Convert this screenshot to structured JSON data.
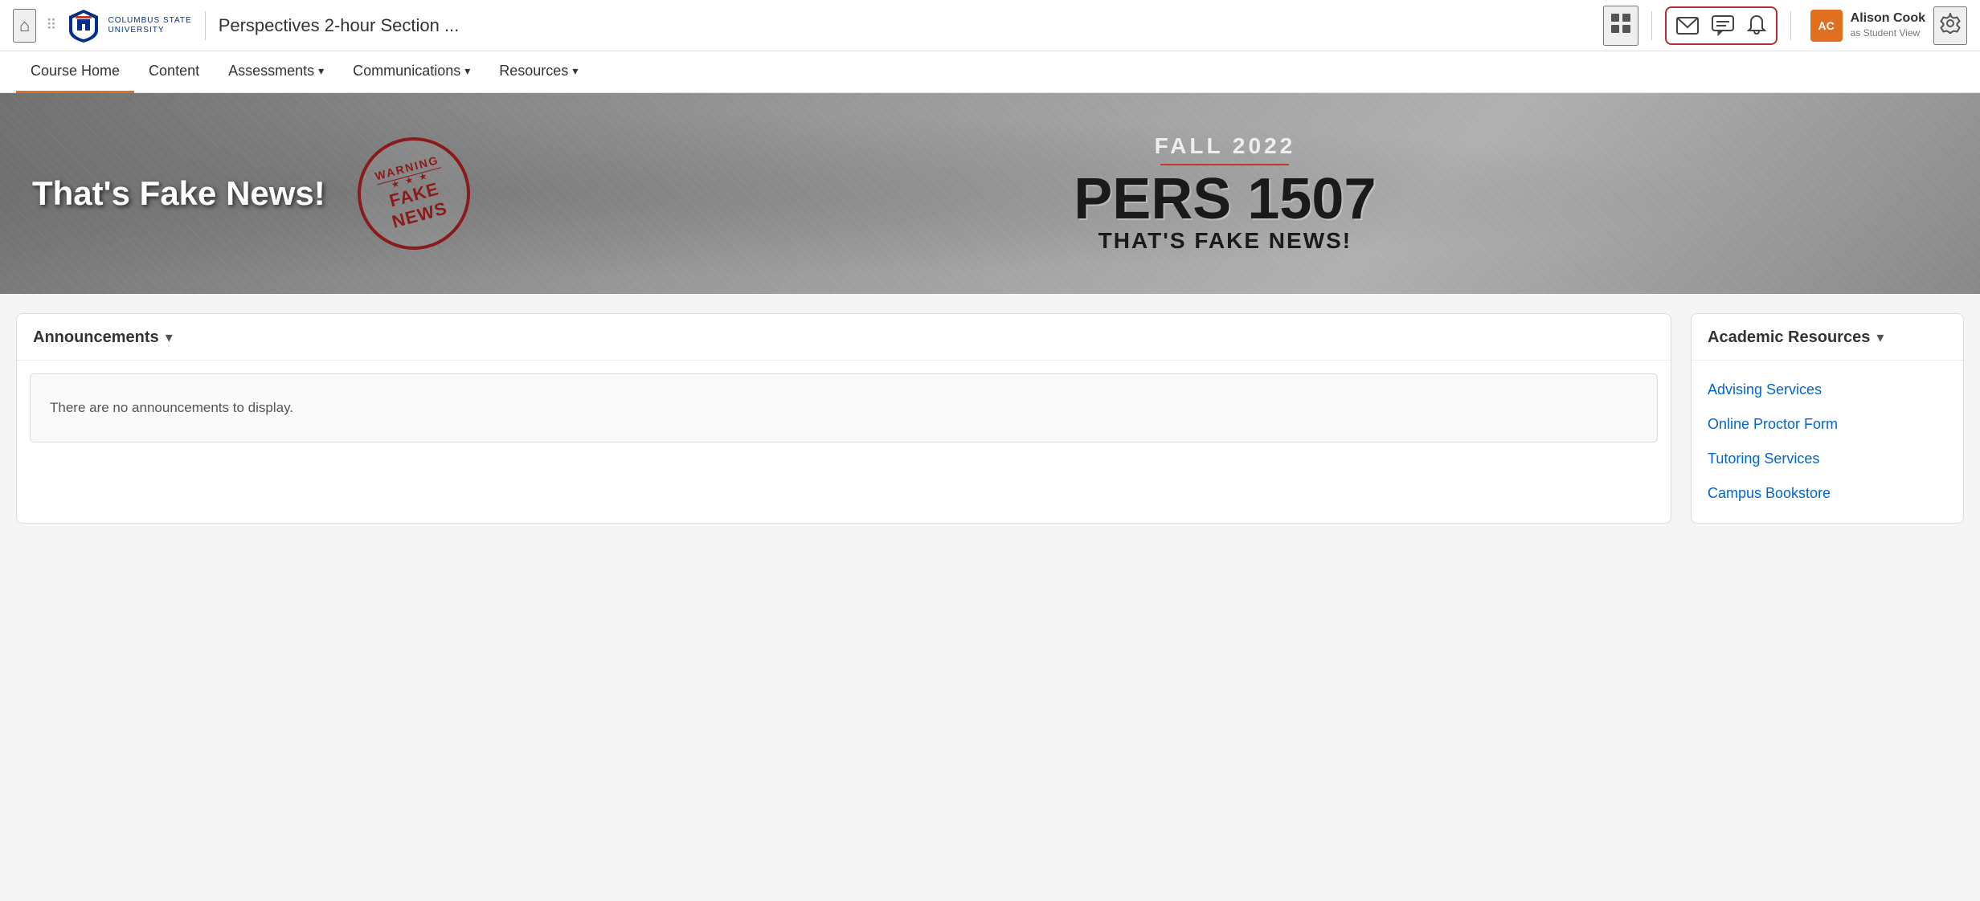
{
  "topbar": {
    "home_icon": "⌂",
    "course_title": "Perspectives 2-hour Section ...",
    "grid_icon": "⊞",
    "mail_icon": "✉",
    "chat_icon": "💬",
    "bell_icon": "🔔",
    "user_initials": "AC",
    "user_name": "Alison Cook",
    "user_role": "as Student View",
    "gear_icon": "⚙"
  },
  "logo": {
    "university_name_line1": "COLUMBUS STATE",
    "university_name_line2": "UNIVERSITY"
  },
  "secondary_nav": {
    "items": [
      {
        "label": "Course Home",
        "active": true,
        "has_caret": false
      },
      {
        "label": "Content",
        "active": false,
        "has_caret": false
      },
      {
        "label": "Assessments",
        "active": false,
        "has_caret": true
      },
      {
        "label": "Communications",
        "active": false,
        "has_caret": true
      },
      {
        "label": "Resources",
        "active": false,
        "has_caret": true
      }
    ]
  },
  "hero": {
    "left_text": "That's Fake News!",
    "stamp_warning": "WARNING",
    "stamp_stars": "★ ★ ★",
    "stamp_fakenews": "FAKE NEWS",
    "fall_label": "FALL 2022",
    "course_code": "PERS 1507",
    "course_subtitle": "THAT'S FAKE NEWS!"
  },
  "announcements": {
    "title": "Announcements",
    "caret": "▾",
    "empty_message": "There are no announcements to display."
  },
  "academic_resources": {
    "title": "Academic Resources",
    "caret": "▾",
    "links": [
      {
        "label": "Advising Services"
      },
      {
        "label": "Online Proctor Form"
      },
      {
        "label": "Tutoring Services"
      },
      {
        "label": "Campus Bookstore"
      }
    ]
  }
}
